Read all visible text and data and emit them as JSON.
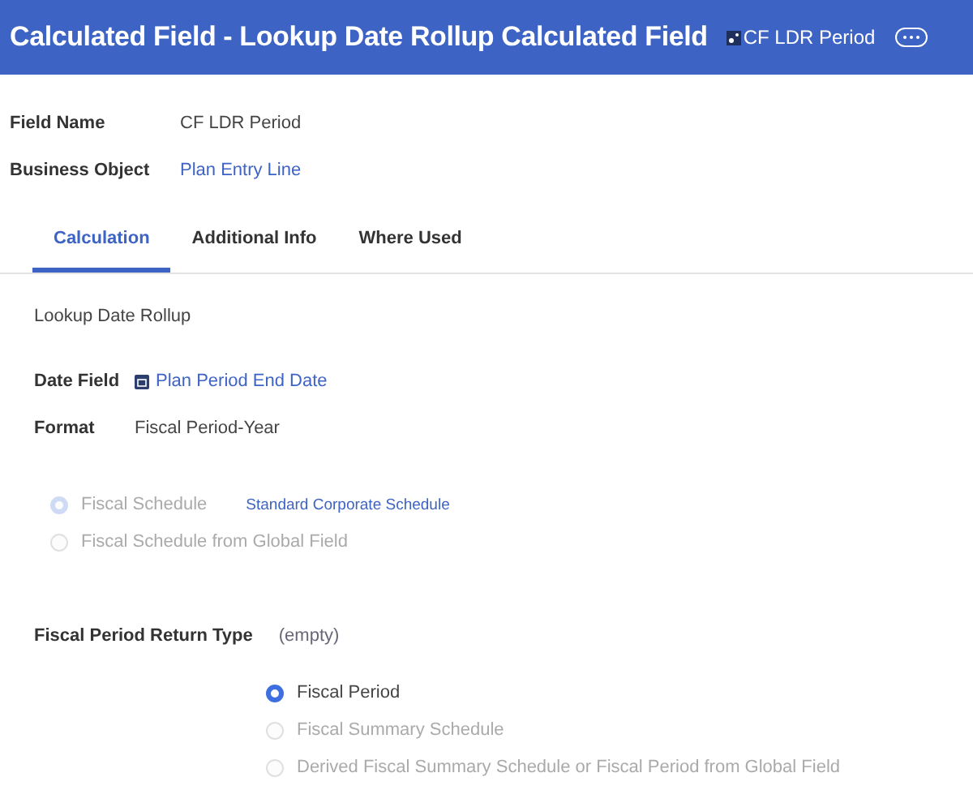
{
  "header": {
    "title": "Calculated Field - Lookup Date Rollup Calculated Field",
    "instance": "CF LDR Period"
  },
  "fields": [
    {
      "label": "Field Name",
      "value": "CF LDR Period",
      "kind": "text"
    },
    {
      "label": "Business Object",
      "value": "Plan Entry Line",
      "kind": "link"
    }
  ],
  "tabs": [
    {
      "label": "Calculation",
      "selected": true
    },
    {
      "label": "Additional Info",
      "selected": false
    },
    {
      "label": "Where Used",
      "selected": false
    }
  ],
  "calculation": {
    "type": "Lookup Date Rollup",
    "fields": [
      {
        "label": "Date Field",
        "value": "Plan Period End Date",
        "kind": "link"
      },
      {
        "label": "Format",
        "value": "Fiscal Period-Year",
        "kind": "text"
      }
    ],
    "schedule_options": [
      {
        "label": "Fiscal Schedule",
        "selected": true,
        "disabled": true,
        "link": "Standard Corporate Schedule"
      },
      {
        "label": "Fiscal Schedule from Global Field",
        "selected": false,
        "disabled": true
      }
    ],
    "return_type": {
      "label": "Fiscal Period Return Type",
      "value": "(empty)"
    },
    "return_options": [
      {
        "label": "Fiscal Period",
        "selected": true,
        "disabled": false
      },
      {
        "label": "Fiscal Summary Schedule",
        "selected": false,
        "disabled": true
      },
      {
        "label": "Derived Fiscal Summary Schedule or Fiscal Period from Global Field",
        "selected": false,
        "disabled": true
      }
    ]
  }
}
